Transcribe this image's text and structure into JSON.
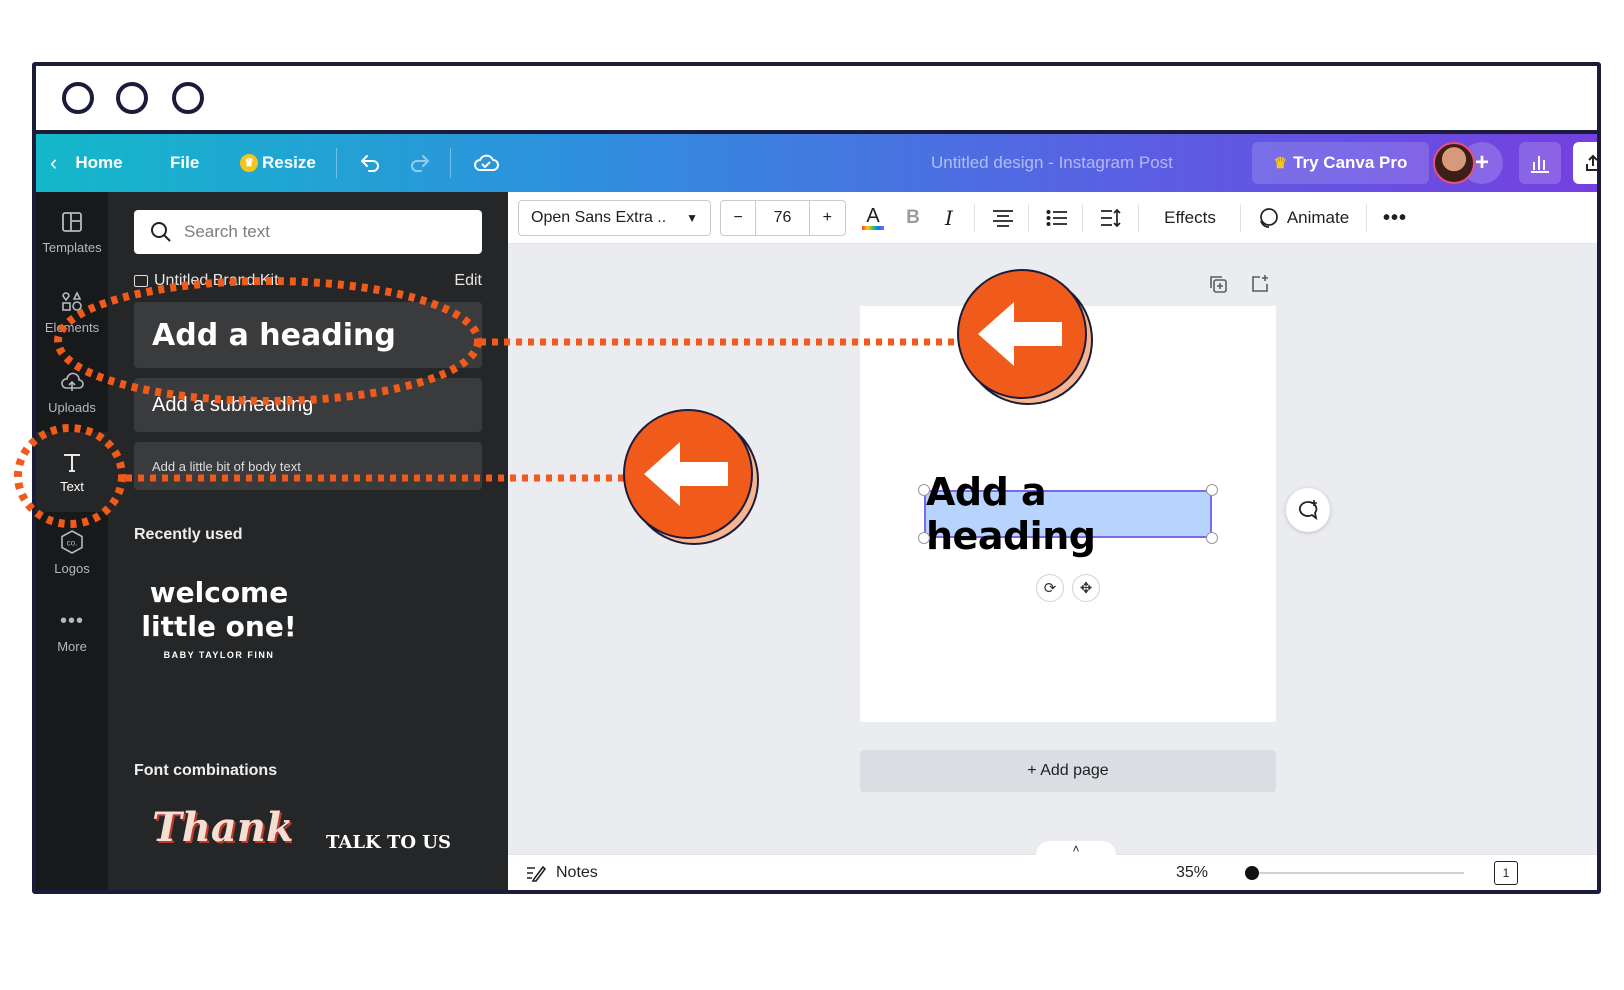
{
  "topbar": {
    "home": "Home",
    "file": "File",
    "resize": "Resize",
    "title": "Untitled design - Instagram Post",
    "try_pro": "Try Canva Pro"
  },
  "rail": {
    "items": [
      {
        "label": "Templates",
        "icon": "templates-icon"
      },
      {
        "label": "Elements",
        "icon": "elements-icon"
      },
      {
        "label": "Uploads",
        "icon": "upload-cloud-icon"
      },
      {
        "label": "Text",
        "icon": "text-icon"
      },
      {
        "label": "Logos",
        "icon": "logos-icon"
      },
      {
        "label": "More",
        "icon": "more-icon"
      }
    ]
  },
  "panel": {
    "search_placeholder": "Search text",
    "brand_kit": "Untitled Brand Kit",
    "edit": "Edit",
    "add_heading": "Add a heading",
    "add_subheading": "Add a subheading",
    "add_body": "Add a little bit of body text",
    "recently_used": "Recently used",
    "recent_line1": "welcome",
    "recent_line2": "little one!",
    "recent_line3": "BABY TAYLOR FINN",
    "font_combinations": "Font combinations",
    "combo1": "Thank",
    "combo2": "TALK TO US"
  },
  "toolbar": {
    "font_family": "Open Sans Extra ..",
    "font_size": "76",
    "minus": "−",
    "plus": "+",
    "effects": "Effects",
    "animate": "Animate"
  },
  "canvas": {
    "heading_text": "Add a heading",
    "add_page": "+ Add page"
  },
  "footer": {
    "notes": "Notes",
    "zoom": "35%",
    "page_count": "1",
    "zoom_level": 0.35
  },
  "colors": {
    "annotation_orange": "#f05a1a",
    "selection_blue": "#b7d4ff",
    "selection_border": "#7b68ee",
    "panel_bg": "#252627",
    "rail_bg": "#18191b"
  }
}
